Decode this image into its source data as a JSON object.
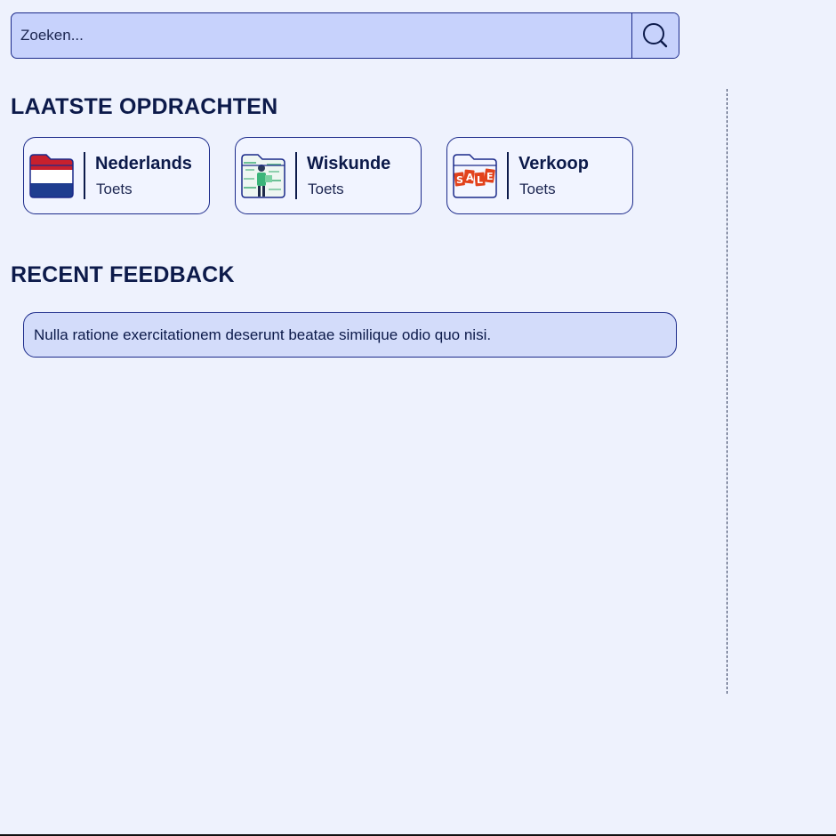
{
  "search": {
    "placeholder": "Zoeken...",
    "button_icon": "search-icon"
  },
  "sections": {
    "tasks_title": "LAATSTE OPDRACHTEN",
    "feedback_title": "RECENT FEEDBACK"
  },
  "tasks": [
    {
      "title": "Nederlands",
      "subtitle": "Toets",
      "icon": "dutch-flag-folder-icon"
    },
    {
      "title": "Wiskunde",
      "subtitle": "Toets",
      "icon": "math-folder-icon"
    },
    {
      "title": "Verkoop",
      "subtitle": "Toets",
      "icon": "sale-folder-icon"
    }
  ],
  "feedback": [
    {
      "text": "Nulla ratione exercitationem deserunt beatae similique odio quo nisi."
    }
  ],
  "colors": {
    "background": "#eef2fd",
    "search_bg": "#c7d2fc",
    "border": "#1b2a8a",
    "text": "#0c1a4a",
    "feedback_bg": "#d3dcfa"
  }
}
